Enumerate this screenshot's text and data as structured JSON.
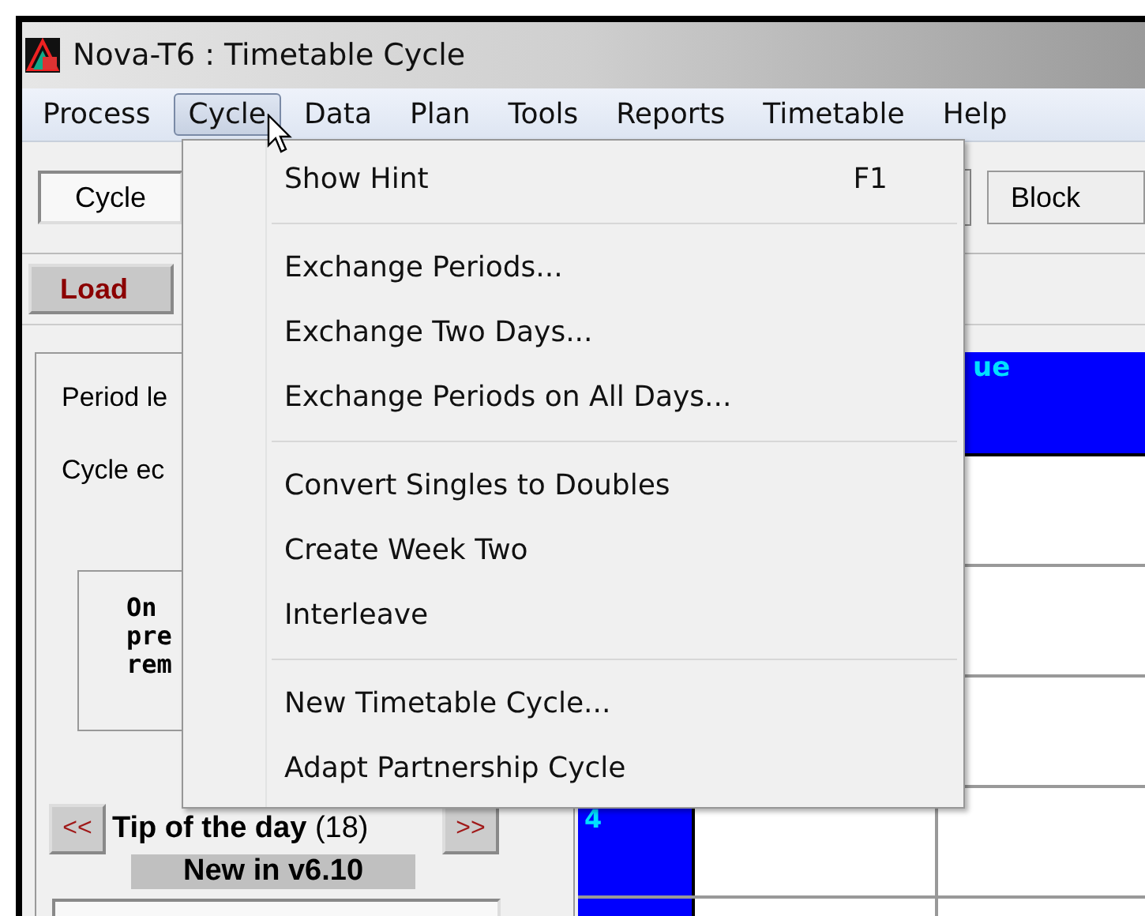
{
  "window": {
    "title": "Nova-T6 : Timetable Cycle"
  },
  "menu_bar": [
    {
      "label": "Process",
      "selected": false
    },
    {
      "label": "Cycle",
      "selected": true
    },
    {
      "label": "Data",
      "selected": false
    },
    {
      "label": "Plan",
      "selected": false
    },
    {
      "label": "Tools",
      "selected": false
    },
    {
      "label": "Reports",
      "selected": false
    },
    {
      "label": "Timetable",
      "selected": false
    },
    {
      "label": "Help",
      "selected": false
    }
  ],
  "toolbar": {
    "cycle_field": {
      "value": "Cycle"
    },
    "block_button": "Block"
  },
  "load_button": "Load",
  "panel": {
    "labels": [
      "Period le",
      "Cycle ec"
    ],
    "notice_lines": [
      "On",
      "pre",
      "rem"
    ],
    "tip": {
      "prev": "<<",
      "title": "Tip of the day",
      "count": "(18)",
      "next": ">>",
      "subtitle": "New in v6.10"
    }
  },
  "grid": {
    "header": "ue",
    "row_labels": [
      "4"
    ]
  },
  "dropdown": [
    {
      "kind": "item",
      "label": "Show Hint",
      "shortcut": "F1"
    },
    {
      "kind": "separator"
    },
    {
      "kind": "item",
      "label": "Exchange Periods..."
    },
    {
      "kind": "item",
      "label": "Exchange Two Days..."
    },
    {
      "kind": "item",
      "label": "Exchange Periods on All Days..."
    },
    {
      "kind": "separator"
    },
    {
      "kind": "item",
      "label": "Convert Singles to Doubles"
    },
    {
      "kind": "item",
      "label": "Create Week Two"
    },
    {
      "kind": "item",
      "label": "Interleave"
    },
    {
      "kind": "separator"
    },
    {
      "kind": "item",
      "label": "New Timetable Cycle..."
    },
    {
      "kind": "item",
      "label": "Adapt Partnership Cycle"
    }
  ]
}
